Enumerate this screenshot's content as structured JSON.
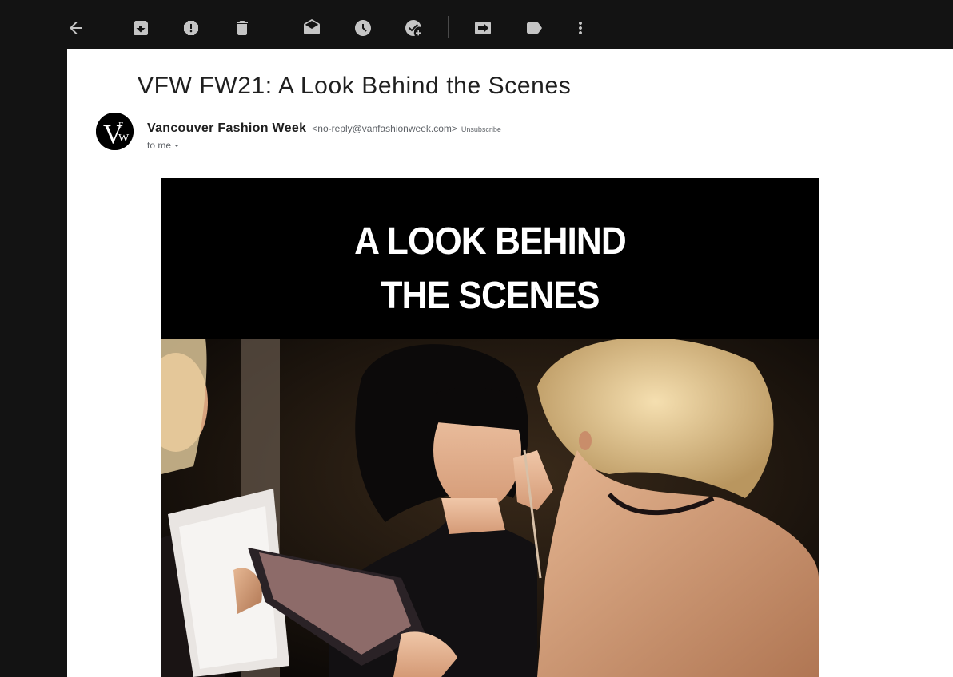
{
  "toolbar": {
    "buttons": [
      {
        "name": "back-button",
        "icon": "arrow-left-icon"
      },
      {
        "name": "archive-button",
        "icon": "archive-icon"
      },
      {
        "name": "report-spam-button",
        "icon": "report-icon"
      },
      {
        "name": "delete-button",
        "icon": "trash-icon"
      },
      {
        "name": "mark-unread-button",
        "icon": "mail-open-icon"
      },
      {
        "name": "snooze-button",
        "icon": "clock-icon"
      },
      {
        "name": "add-to-tasks-button",
        "icon": "task-add-icon"
      },
      {
        "name": "move-to-button",
        "icon": "move-to-icon"
      },
      {
        "name": "labels-button",
        "icon": "label-icon"
      },
      {
        "name": "more-button",
        "icon": "more-vert-icon"
      }
    ],
    "icon_color": "#c5c5c5"
  },
  "email": {
    "subject": "VFW FW21: A Look Behind the Scenes",
    "sender_name": "Vancouver Fashion Week",
    "sender_email": "<no-reply@vanfashionweek.com>",
    "unsubscribe_label": "Unsubscribe",
    "recipient_label": "to me",
    "avatar_logo_text": "VFW"
  },
  "body": {
    "hero_heading_line1": "A LOOK BEHIND",
    "hero_heading_line2": "THE SCENES"
  },
  "colors": {
    "app_background": "#131313",
    "mail_background": "#ffffff",
    "hero_background": "#000000"
  }
}
